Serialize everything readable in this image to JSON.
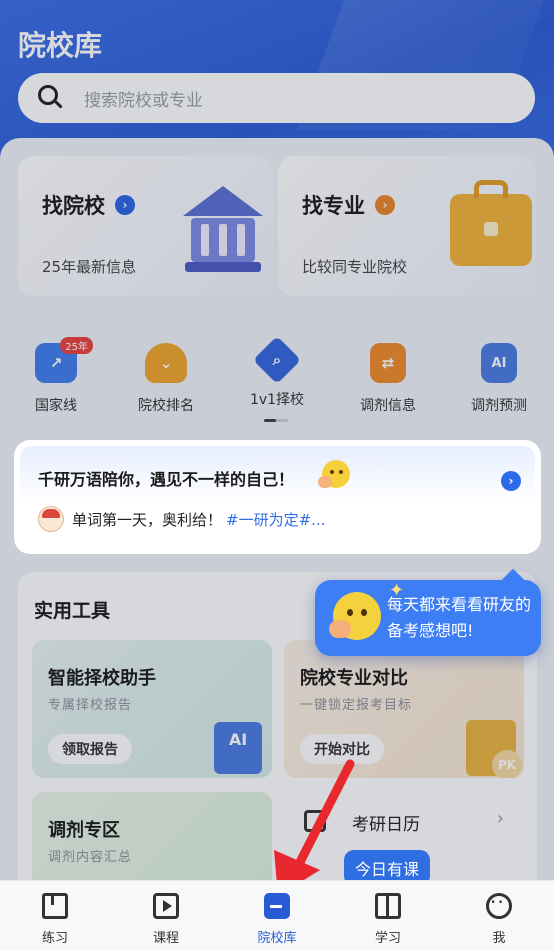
{
  "header": {
    "title": "院校库",
    "search": {
      "placeholder": "搜索院校或专业"
    }
  },
  "feature_cards": [
    {
      "title": "找院校",
      "subtitle": "25年最新信息",
      "badge_color": "#2c63e3",
      "icon": "bank-illustration"
    },
    {
      "title": "找专业",
      "subtitle": "比较同专业院校",
      "badge_color": "#e8852a",
      "icon": "briefcase-illustration"
    }
  ],
  "shortcuts": [
    {
      "label": "国家线",
      "icon": "trend-chart-icon",
      "badge": "25年",
      "color": "#3f7ef0"
    },
    {
      "label": "院校排名",
      "icon": "trophy-icon",
      "color": "#f0a52a"
    },
    {
      "label": "1v1择校",
      "icon": "search-diamond-icon",
      "color": "#3366dd"
    },
    {
      "label": "调剂信息",
      "icon": "document-swap-icon",
      "color": "#f08a2a"
    },
    {
      "label": "调剂预测",
      "icon": "ai-document-icon",
      "color": "#4a7be3"
    }
  ],
  "post": {
    "title": "千研万语陪你，遇见不一样的自己！",
    "text": "单词第一天，奥利给！",
    "tag": "#一研为定#..."
  },
  "bubble": {
    "text": "每天都来看看研友的备考感想吧!"
  },
  "tools": {
    "title": "实用工具",
    "cards": [
      {
        "title": "智能择校助手",
        "subtitle": "专属择校报告",
        "button": "领取报告"
      },
      {
        "title": "院校专业对比",
        "subtitle": "一键锁定报考目标",
        "button": "开始对比"
      },
      {
        "title": "调剂专区",
        "subtitle": "调剂内容汇总"
      }
    ],
    "calendar": {
      "label": "考研日历"
    }
  },
  "today_pill": "今日有课",
  "tabbar": [
    {
      "label": "练习",
      "icon": "practice-book-icon"
    },
    {
      "label": "课程",
      "icon": "video-play-icon"
    },
    {
      "label": "院校库",
      "icon": "school-folder-icon",
      "active": true
    },
    {
      "label": "学习",
      "icon": "open-book-icon"
    },
    {
      "label": "我",
      "icon": "chat-face-icon"
    }
  ],
  "colors": {
    "brand_blue": "#2f62d9",
    "active_tab": "#2a5bd7",
    "annotation_arrow": "#e8282e"
  }
}
